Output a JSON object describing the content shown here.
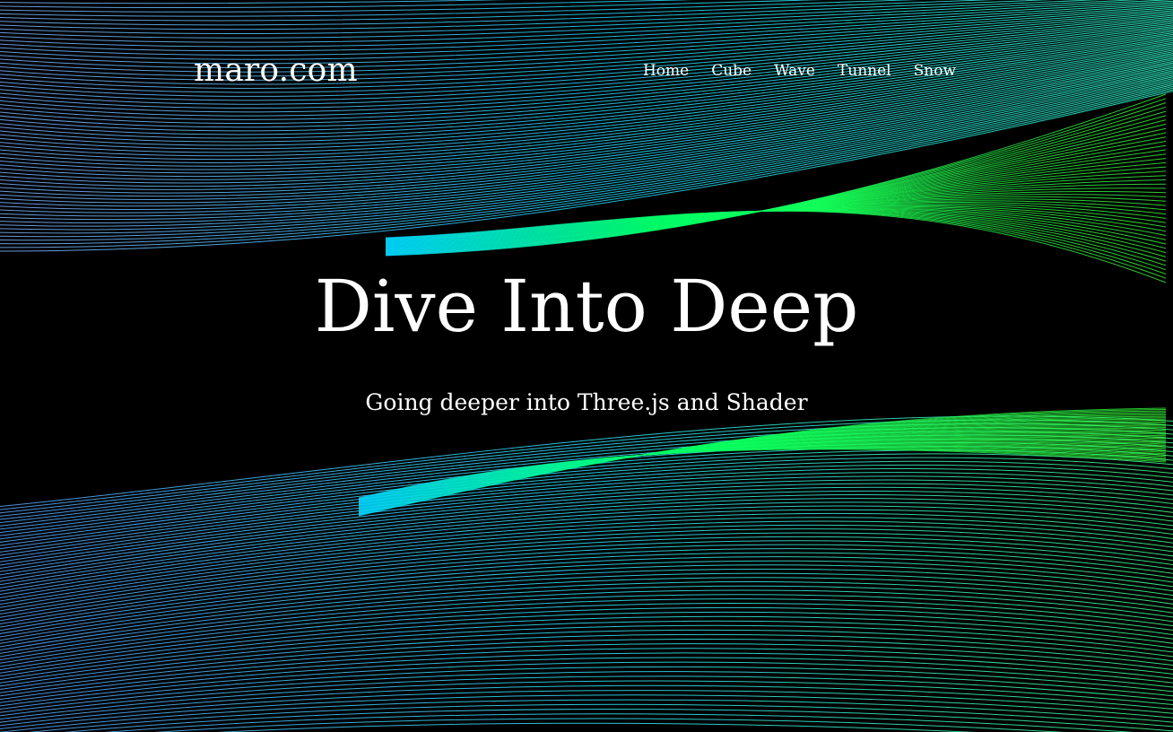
{
  "site": {
    "logo": "maro.com"
  },
  "nav": {
    "items": [
      {
        "label": "Home"
      },
      {
        "label": "Cube"
      },
      {
        "label": "Wave"
      },
      {
        "label": "Tunnel"
      },
      {
        "label": "Snow"
      }
    ]
  },
  "hero": {
    "title": "Dive Into Deep",
    "subtitle": "Going deeper into Three.js and Shader"
  },
  "colors": {
    "background": "#000000",
    "text": "#ffffff",
    "line_blue": "#5aa8ff",
    "line_cyan": "#00e5ff",
    "line_green": "#2bff3a"
  }
}
